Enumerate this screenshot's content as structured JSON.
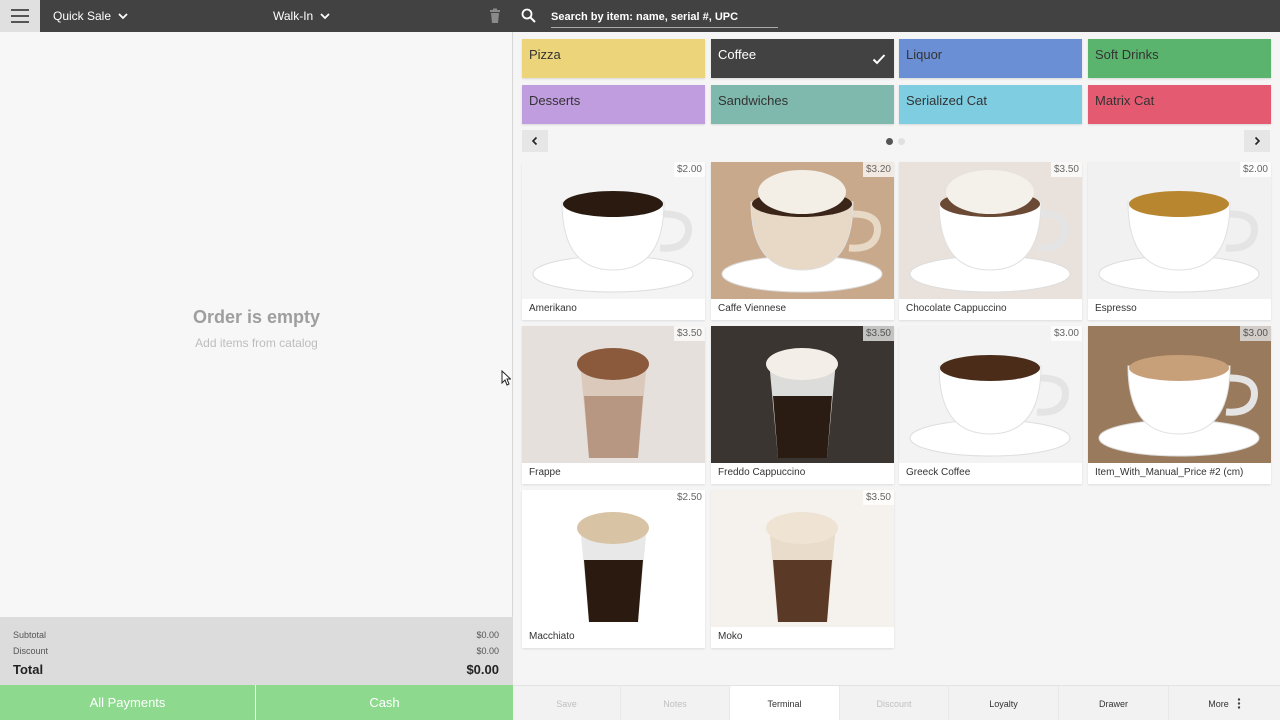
{
  "left_header": {
    "sale_type": "Quick Sale",
    "customer": "Walk-In"
  },
  "order": {
    "empty_title": "Order is empty",
    "empty_subtitle": "Add items from catalog"
  },
  "totals": {
    "subtotal_label": "Subtotal",
    "subtotal_value": "$0.00",
    "discount_label": "Discount",
    "discount_value": "$0.00",
    "total_label": "Total",
    "total_value": "$0.00"
  },
  "payments": {
    "all_label": "All Payments",
    "cash_label": "Cash"
  },
  "search": {
    "placeholder": "Search by item: name, serial #, UPC"
  },
  "categories": [
    {
      "label": "Pizza",
      "color": "#ecd47b",
      "selected": false
    },
    {
      "label": "Coffee",
      "color": "#424242",
      "selected": true
    },
    {
      "label": "Liquor",
      "color": "#6b8fd4",
      "selected": false
    },
    {
      "label": "Soft Drinks",
      "color": "#5bb46e",
      "selected": false
    },
    {
      "label": "Desserts",
      "color": "#c09ddf",
      "selected": false
    },
    {
      "label": "Sandwiches",
      "color": "#7fb8ac",
      "selected": false
    },
    {
      "label": "Serialized Cat",
      "color": "#7fcde0",
      "selected": false
    },
    {
      "label": "Matrix Cat",
      "color": "#e45a70",
      "selected": false
    }
  ],
  "pager": {
    "current_page": 1,
    "page_count": 2
  },
  "items": [
    {
      "name": "Amerikano",
      "price": "$2.00"
    },
    {
      "name": "Caffe Viennese",
      "price": "$3.20"
    },
    {
      "name": "Chocolate Cappuccino",
      "price": "$3.50"
    },
    {
      "name": "Espresso",
      "price": "$2.00"
    },
    {
      "name": "Frappe",
      "price": "$3.50"
    },
    {
      "name": "Freddo Cappuccino",
      "price": "$3.50"
    },
    {
      "name": "Greeck Coffee",
      "price": "$3.00"
    },
    {
      "name": "Item_With_Manual_Price #2 (cm)",
      "price": "$3.00"
    },
    {
      "name": "Macchiato",
      "price": "$2.50"
    },
    {
      "name": "Moko",
      "price": "$3.50"
    }
  ],
  "bottom_actions": {
    "save": "Save",
    "notes": "Notes",
    "terminal": "Terminal",
    "discount": "Discount",
    "loyalty": "Loyalty",
    "drawer": "Drawer",
    "more": "More"
  },
  "icons": {
    "menu": "hamburger-icon",
    "dropdown": "chevron-down-icon",
    "trash": "trash-icon",
    "search": "search-icon",
    "selected": "checkmark-icon",
    "prev": "chevron-left-icon",
    "next": "chevron-right-icon",
    "more": "vertical-dots-icon"
  }
}
